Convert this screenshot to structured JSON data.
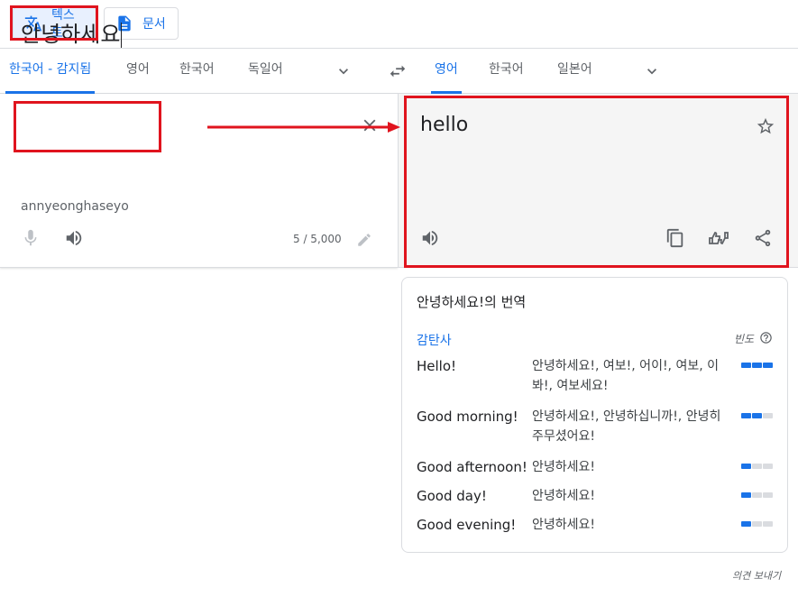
{
  "modes": {
    "text_label": "텍스트",
    "doc_label": "문서"
  },
  "source_langs": {
    "tabs": [
      "한국어 - 감지됨",
      "영어",
      "한국어",
      "독일어"
    ],
    "active_index": 0
  },
  "target_langs": {
    "tabs": [
      "영어",
      "한국어",
      "일본어"
    ],
    "active_index": 0
  },
  "source": {
    "text": "안녕하세요",
    "romanization": "annyeonghaseyo",
    "char_count": "5 / 5,000"
  },
  "target": {
    "text": "hello"
  },
  "dictionary": {
    "title": "안녕하세요!의 번역",
    "part_of_speech": "감탄사",
    "frequency_label": "빈도",
    "rows": [
      {
        "word": "Hello!",
        "translations": "안녕하세요!, 여보!, 어이!, 여보, 이봐!, 여보세요!",
        "frequency": 3
      },
      {
        "word": "Good morning!",
        "translations": "안녕하세요!, 안녕하십니까!, 안녕히 주무셨어요!",
        "frequency": 2
      },
      {
        "word": "Good afternoon!",
        "translations": "안녕하세요!",
        "frequency": 1
      },
      {
        "word": "Good day!",
        "translations": "안녕하세요!",
        "frequency": 1
      },
      {
        "word": "Good evening!",
        "translations": "안녕하세요!",
        "frequency": 1
      }
    ]
  },
  "feedback_label": "의견 보내기",
  "colors": {
    "accent": "#1a73e8",
    "annotation": "#e0141e",
    "target_bg": "#f5f5f5"
  },
  "icons": [
    "translate-icon",
    "document-icon",
    "chevron-down-icon",
    "swap-icon",
    "close-icon",
    "mic-icon",
    "speaker-icon",
    "pencil-icon",
    "star-icon",
    "copy-icon",
    "feedback-thumbs-icon",
    "share-icon",
    "help-icon"
  ]
}
